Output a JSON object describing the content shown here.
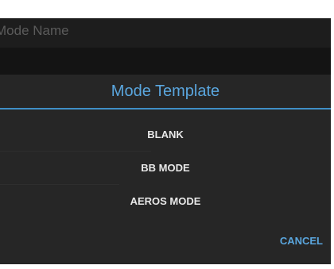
{
  "mode_name": {
    "placeholder": "Mode Name"
  },
  "dialog": {
    "title": "Mode Template",
    "items": [
      {
        "label": "BLANK"
      },
      {
        "label": "BB MODE"
      },
      {
        "label": "AEROS MODE"
      }
    ],
    "cancel_label": "CANCEL",
    "accent_color": "#5aa6de"
  }
}
